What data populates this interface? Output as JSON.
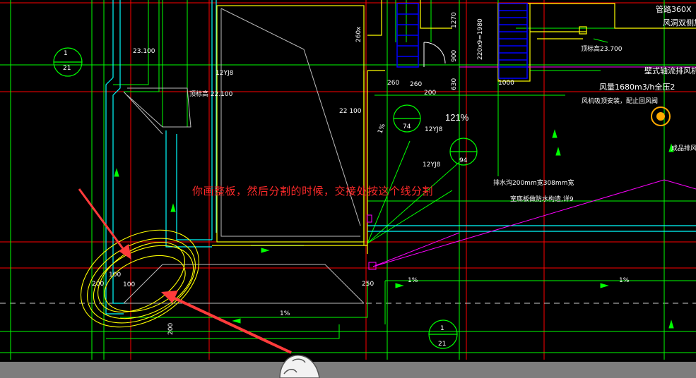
{
  "annotation": "你画整板，然后分割的时候，交接处按这个线分割",
  "zoom_label": "121%",
  "dims": {
    "d260": "260",
    "d200": "200",
    "d1000": "1000",
    "d1270": "1270",
    "d900": "900",
    "d630": "630",
    "d220": "220x9=1980",
    "d200b": "200",
    "d200c": "200",
    "d100": "100",
    "d100b": "100",
    "d250": "250",
    "d22100": "22 100",
    "d360": "管路360X",
    "d1680": "风量1680m3/h全压2",
    "d23700": "顶标高23.700",
    "d22t": "顶标高 22.100",
    "d260x": "260x",
    "d23y": "23.100"
  },
  "labels": {
    "circ21": "21",
    "circ21b": "1",
    "circ21c": "21",
    "circ74": "74",
    "circ94": "94",
    "lbl12yj8": "12YJ8",
    "lbl12yj8b": "12YJ8",
    "lbl12yj8c": "12YJ8",
    "side1": "壁式轴流排风机",
    "side2": "风机吸顶安装，配止回风阀",
    "side3": "风洞双侧加",
    "side4": "成品排风口",
    "slope1": "1%",
    "slope2": "1%",
    "slope3": "1%",
    "slope4": "1%",
    "drain": "排水沟200mm宽308mm宽",
    "drain2": "室底板做防水构造,详9"
  },
  "colors": {
    "bg": "#000000",
    "green": "#00ff00",
    "yellow": "#ffff00",
    "cyan": "#00ffff",
    "red": "#ff0000",
    "magenta": "#ff00ff",
    "blue": "#0000ff",
    "white": "#ffffff",
    "annotation": "#ff2a2a",
    "gray": "#7d7d7d"
  }
}
